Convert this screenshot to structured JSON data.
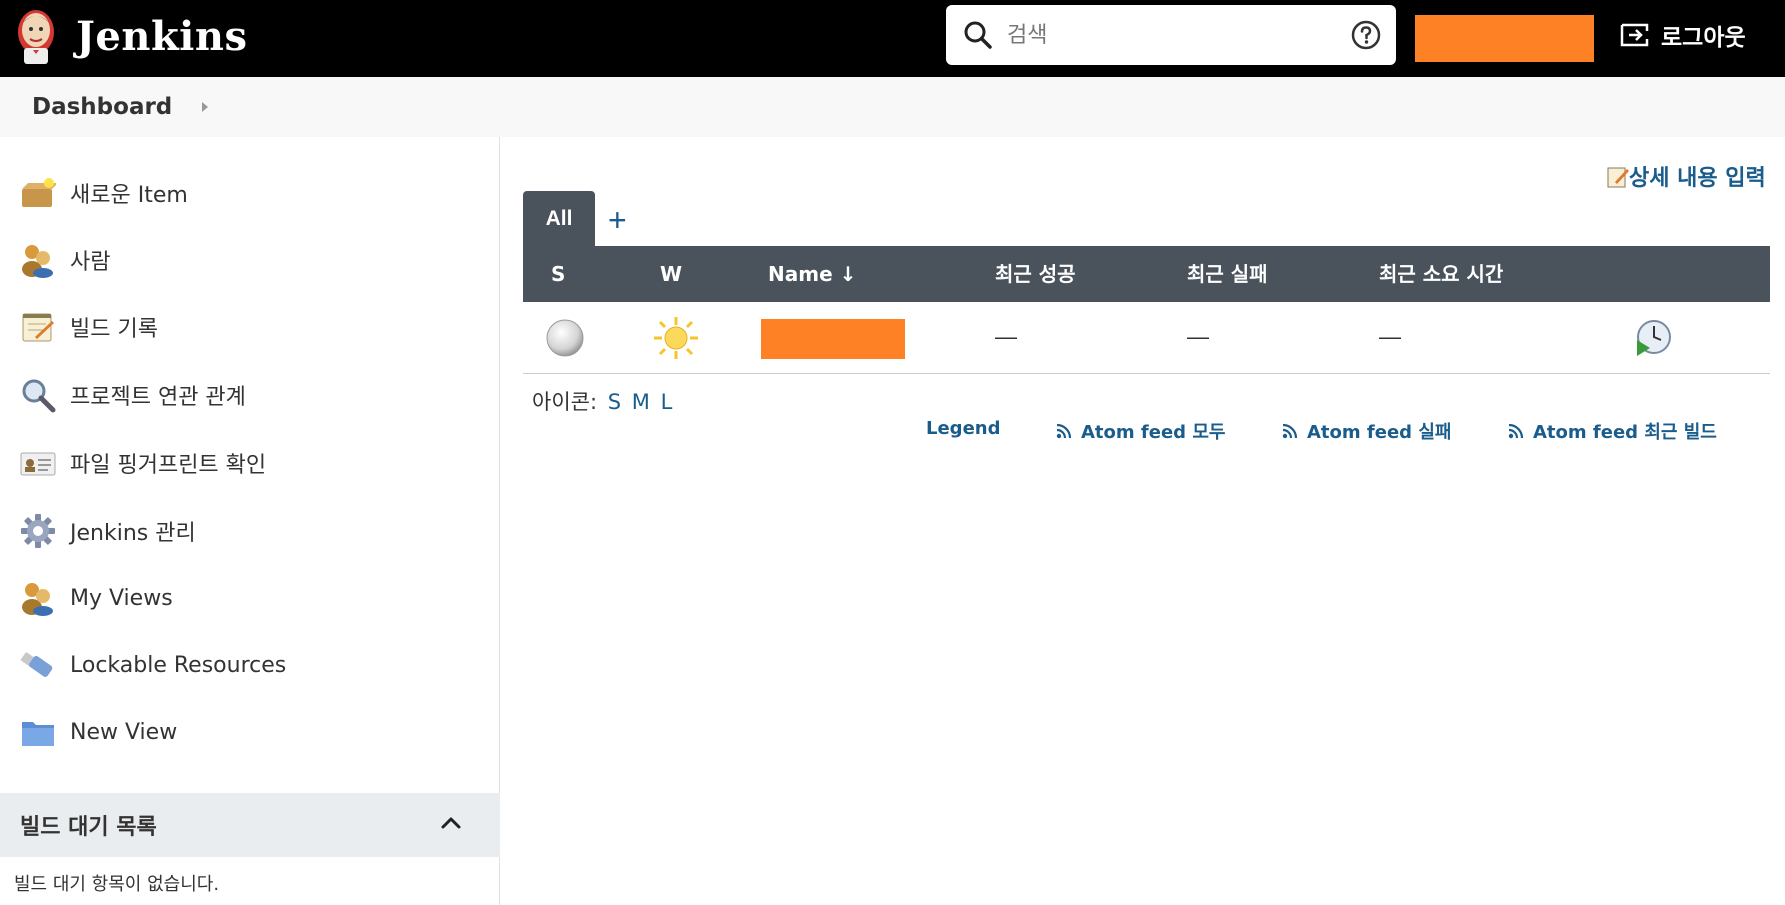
{
  "header": {
    "app_name": "Jenkins",
    "search_placeholder": "검색",
    "logout_label": "로그아웃",
    "colors": {
      "background": "#000000",
      "user_button": "#fe8225"
    }
  },
  "breadcrumb": {
    "items": [
      "Dashboard"
    ]
  },
  "sidebar": {
    "items": [
      {
        "label": "새로운 Item",
        "icon": "new-item-icon"
      },
      {
        "label": "사람",
        "icon": "people-icon"
      },
      {
        "label": "빌드 기록",
        "icon": "notepad-icon"
      },
      {
        "label": "프로젝트 연관 관계",
        "icon": "magnifier-icon"
      },
      {
        "label": "파일 핑거프린트 확인",
        "icon": "fingerprint-icon"
      },
      {
        "label": "Jenkins 관리",
        "icon": "gear-icon"
      },
      {
        "label": "My Views",
        "icon": "user-icon"
      },
      {
        "label": "Lockable Resources",
        "icon": "usb-icon"
      },
      {
        "label": "New View",
        "icon": "folder-icon"
      }
    ],
    "build_queue": {
      "title": "빌드 대기 목록",
      "empty_text": "빌드 대기 항목이 없습니다."
    }
  },
  "main": {
    "edit_description": "상세 내용 입력",
    "tabs": [
      {
        "label": "All",
        "active": true
      }
    ],
    "add_tab": "+",
    "columns": [
      "S",
      "W",
      "Name ↓",
      "최근 성공",
      "최근 실패",
      "최근 소요 시간"
    ],
    "rows": [
      {
        "status": "not-built",
        "weather": "sunny",
        "name": "",
        "last_success": "—",
        "last_failure": "—",
        "last_duration": "—"
      }
    ],
    "icon_size": {
      "label": "아이콘:",
      "options": [
        "S",
        "M",
        "L"
      ]
    },
    "footer_links": [
      "Legend",
      "Atom feed 모두",
      "Atom feed 실패",
      "Atom feed 최근 빌드"
    ],
    "colors": {
      "table_header": "#4a525c",
      "link": "#1a5d8c",
      "redacted": "#fe8225"
    }
  }
}
